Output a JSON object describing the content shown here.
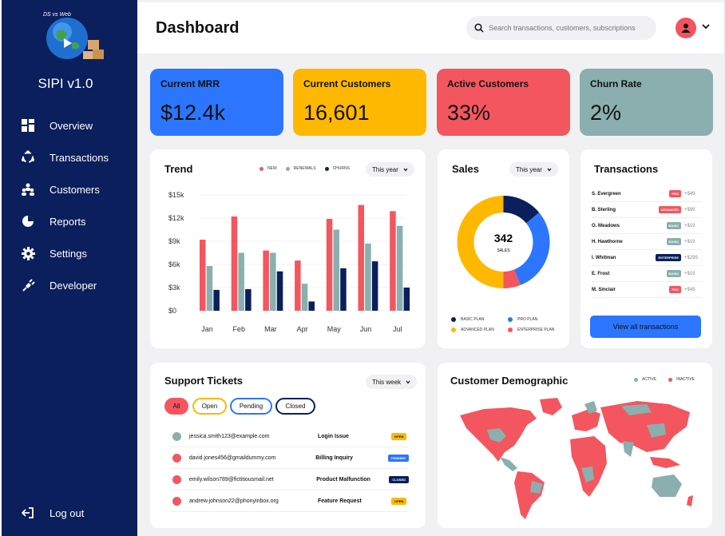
{
  "sidebar": {
    "logo_text": "DS vs Web",
    "app_title": "SIPI v1.0",
    "items": [
      {
        "label": "Overview",
        "icon": "grid-icon"
      },
      {
        "label": "Transactions",
        "icon": "cycle-icon"
      },
      {
        "label": "Customers",
        "icon": "people-icon"
      },
      {
        "label": "Reports",
        "icon": "pie-icon"
      },
      {
        "label": "Settings",
        "icon": "gear-icon"
      },
      {
        "label": "Developer",
        "icon": "plug-icon"
      }
    ],
    "logout_label": "Log out"
  },
  "header": {
    "title": "Dashboard",
    "search_placeholder": "Search transactions, customers, subscriptions"
  },
  "kpis": [
    {
      "title": "Current MRR",
      "value": "$12.4k",
      "color": "#2c76ff"
    },
    {
      "title": "Current Customers",
      "value": "16,601",
      "color": "#ffb800"
    },
    {
      "title": "Active Customers",
      "value": "33%",
      "color": "#f4565f"
    },
    {
      "title": "Churn Rate",
      "value": "2%",
      "color": "#8aafae"
    }
  ],
  "trend": {
    "title": "Trend",
    "range_label": "This year",
    "legend": [
      "NEW",
      "RENEWALS",
      "CHURNS"
    ]
  },
  "chart_data": {
    "type": "bar",
    "categories": [
      "Jan",
      "Feb",
      "Mar",
      "Apr",
      "May",
      "Jun",
      "Jul"
    ],
    "series": [
      {
        "name": "NEW",
        "color": "#f4565f",
        "values": [
          9.2,
          12.2,
          7.8,
          6.5,
          11.9,
          13.7,
          12.9
        ]
      },
      {
        "name": "RENEWALS",
        "color": "#8aafae",
        "values": [
          5.8,
          7.5,
          7.5,
          3.5,
          10.5,
          8.7,
          11.0
        ]
      },
      {
        "name": "CHURNS",
        "color": "#0a1f5c",
        "values": [
          2.7,
          2.8,
          5.1,
          1.2,
          5.5,
          6.4,
          3.0
        ]
      }
    ],
    "y_ticks": [
      "$0",
      "$3k",
      "$6k",
      "$9k",
      "$12k",
      "$15k"
    ],
    "ylim": [
      0,
      15
    ]
  },
  "sales": {
    "title": "Sales",
    "range_label": "This year",
    "total": "342",
    "total_label": "SALES",
    "segments": [
      {
        "name": "BASIC PLAN",
        "value": 14,
        "color": "#0a1f5c"
      },
      {
        "name": "PRO PLAN",
        "value": 30,
        "color": "#2c76ff"
      },
      {
        "name": "ENTERPRISE PLAN",
        "value": 6,
        "color": "#f4565f"
      },
      {
        "name": "ADVANCED PLAN",
        "value": 50,
        "color": "#ffb800"
      }
    ]
  },
  "transactions": {
    "title": "Transactions",
    "rows": [
      {
        "name": "S. Evergreen",
        "plan": "PRO",
        "plan_color": "#f4565f",
        "amount": "+$49"
      },
      {
        "name": "B. Sterling",
        "plan": "ADVANCED",
        "plan_color": "#f4565f",
        "amount": "+$99"
      },
      {
        "name": "O. Meadows",
        "plan": "BASIC",
        "plan_color": "#8aafae",
        "amount": "+$19"
      },
      {
        "name": "H. Hawthorne",
        "plan": "BASIC",
        "plan_color": "#8aafae",
        "amount": "+$19"
      },
      {
        "name": "I. Whitman",
        "plan": "ENTERPRISE",
        "plan_color": "#0a1f5c",
        "amount": "+$299"
      },
      {
        "name": "E. Frost",
        "plan": "BASIC",
        "plan_color": "#8aafae",
        "amount": "+$19"
      },
      {
        "name": "M. Sinclair",
        "plan": "PRO",
        "plan_color": "#f4565f",
        "amount": "+$49"
      }
    ],
    "view_all_label": "View all transactions"
  },
  "support": {
    "title": "Support Tickets",
    "range_label": "This week",
    "filters": [
      {
        "label": "All",
        "color": "#f4565f"
      },
      {
        "label": "Open",
        "color": "#ffb800"
      },
      {
        "label": "Pending",
        "color": "#2c76ff"
      },
      {
        "label": "Closed",
        "color": "#0a1f5c"
      }
    ],
    "tickets": [
      {
        "email": "jessica.smith123@example.com",
        "issue": "Login Issue",
        "status": "OPEN",
        "status_color": "#ffb800",
        "dot": "#8aafae"
      },
      {
        "email": "david.jones456@gmaildummy.com",
        "issue": "Billing Inquiry",
        "status": "PENDING",
        "status_color": "#2c76ff",
        "dot": "#f4565f"
      },
      {
        "email": "emily.wilson789@fictitiousmail.net",
        "issue": "Product Malfunction",
        "status": "CLOSED",
        "status_color": "#0a1f5c",
        "dot": "#f4565f"
      },
      {
        "email": "andrew.johnson22@phonyinbox.org",
        "issue": "Feature Request",
        "status": "OPEN",
        "status_color": "#ffb800",
        "dot": "#f4565f"
      }
    ]
  },
  "demographic": {
    "title": "Customer Demographic",
    "legend": [
      {
        "label": "ACTIVE",
        "color": "#8aafae"
      },
      {
        "label": "INACTIVE",
        "color": "#f4565f"
      }
    ]
  }
}
